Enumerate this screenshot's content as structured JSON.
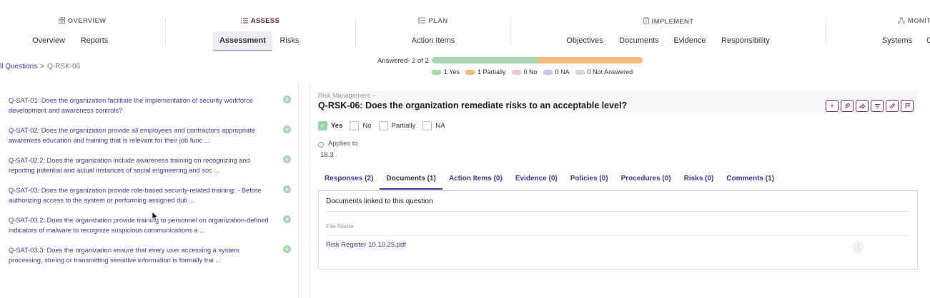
{
  "nav": {
    "groups": [
      {
        "id": "overview",
        "label": "OVERVIEW",
        "icon": "grid-icon"
      },
      {
        "id": "assess",
        "label": "ASSESS",
        "icon": "list-icon"
      },
      {
        "id": "plan",
        "label": "PLAN",
        "icon": "checklist-icon"
      },
      {
        "id": "implement",
        "label": "IMPLEMENT",
        "icon": "clipboard-icon"
      },
      {
        "id": "monitor",
        "label": "MONIT",
        "icon": "network-icon"
      }
    ],
    "tabs": {
      "overview": "Overview",
      "reports": "Reports",
      "assessment": "Assessment",
      "risks": "Risks",
      "action_items": "Action Items",
      "objectives": "Objectives",
      "documents": "Documents",
      "evidence": "Evidence",
      "responsibility": "Responsibility",
      "systems": "Systems",
      "more": "C"
    },
    "active_group": "ASSESS",
    "active_tab": "Assessment",
    "accent_color": "#6b1f4e"
  },
  "breadcrumb": {
    "parent": "ll Questions",
    "separator": ">",
    "current": "Q-RSK-06"
  },
  "progress": {
    "answered_label": "Answered- 2 of 2",
    "yes_fraction": 0.5,
    "partially_fraction": 0.5,
    "legend": [
      {
        "label": "1 Yes",
        "color": "#a8d8b3"
      },
      {
        "label": "1 Partially",
        "color": "#f4b87c"
      },
      {
        "label": "0 No",
        "color": "#f5c6c6"
      },
      {
        "label": "0 NA",
        "color": "#c3c3ee"
      },
      {
        "label": "0 Not Answered",
        "color": "#d5d5d5"
      }
    ]
  },
  "questions": [
    {
      "text": "Q-SAT-01: Does the organization facilitate the implementation of security workforce development and awareness controls?",
      "status_color": "#a8d5b0"
    },
    {
      "text": "Q-SAT-02: Does the organization provide all employees and contractors appropriate awareness education and training that is relevant for their job func ...",
      "status_color": "#a8d5b0"
    },
    {
      "text": "Q-SAT-02.2: Does the organization include awareness training on recognizing and reporting potential and actual instances of social engineering and soc ...",
      "status_color": "#a8d5b0"
    },
    {
      "text": "Q-SAT-03: Does the organization provide role-based security-related training: - Before authorizing access to the system or performing assigned duti ...",
      "status_color": "#a8d5b0"
    },
    {
      "text": "Q-SAT-03.2: Does the organization provide training to personnel on organization-defined indicators of malware to recognize suspicious communications a ...",
      "status_color": "#a8d5b0"
    },
    {
      "text": "Q-SAT-03.3: Does the organization ensure that every user accessing a system processing, storing or transmitting sensitive information is formally trai ...",
      "status_color": "#a8d5b0"
    }
  ],
  "detail": {
    "category": "Risk Management --",
    "title": "Q-RSK-06: Does the organization remediate risks to an acceptable level?",
    "toolbar": [
      "plus-icon",
      "paperclip-icon",
      "share-icon",
      "filter-icon",
      "edit-icon",
      "flag-icon"
    ],
    "options": [
      {
        "label": "Yes",
        "checked": true
      },
      {
        "label": "No",
        "checked": false
      },
      {
        "label": "Partially",
        "checked": false
      },
      {
        "label": "NA",
        "checked": false
      }
    ],
    "applies_label": "Applies to",
    "applies_value": "18.3",
    "tabs": [
      {
        "label": "Responses (2)",
        "active": false
      },
      {
        "label": "Documents (1)",
        "active": true
      },
      {
        "label": "Action Items (0)",
        "active": false
      },
      {
        "label": "Evidence (0)",
        "active": false
      },
      {
        "label": "Policies (0)",
        "active": false
      },
      {
        "label": "Procedures (0)",
        "active": false
      },
      {
        "label": "Risks (0)",
        "active": false
      },
      {
        "label": "Comments (1)",
        "active": false
      }
    ],
    "documents": {
      "heading": "Documents linked to this question",
      "column": "File Name",
      "files": [
        "Risk Register 10.10.25.pdf"
      ],
      "more_glyph": "⋮"
    }
  }
}
